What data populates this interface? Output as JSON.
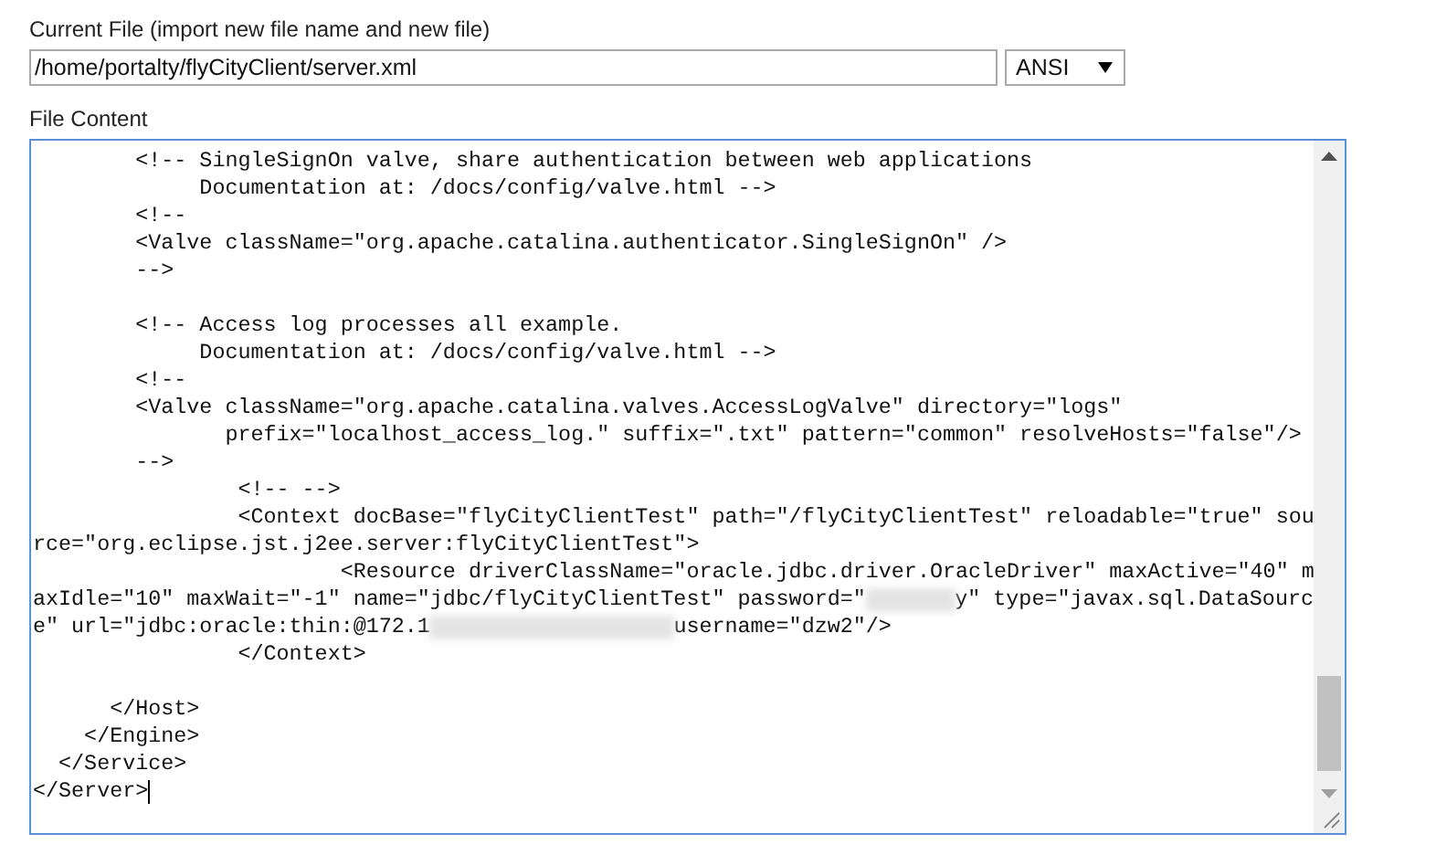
{
  "current_file": {
    "label": "Current File (import new file name and new file)",
    "value": "/home/portalty/flyCityClient/server.xml",
    "encoding": "ANSI"
  },
  "file_content": {
    "label": "File Content",
    "blocks": [
      [
        "        <!-- SingleSignOn valve, share authentication between web applications",
        "             Documentation at: /docs/config/valve.html -->",
        "        <!--",
        "        <Valve className=\"org.apache.catalina.authenticator.SingleSignOn\" />",
        "        -->"
      ],
      [
        "        <!-- Access log processes all example.",
        "             Documentation at: /docs/config/valve.html -->",
        "        <!--",
        "        <Valve className=\"org.apache.catalina.valves.AccessLogValve\" directory=\"logs\"",
        "               prefix=\"localhost_access_log.\" suffix=\".txt\" pattern=\"common\" resolveHosts=\"false\"/>",
        "        -->",
        "                <!-- -->",
        "                <Context docBase=\"flyCityClientTest\" path=\"/flyCityClientTest\" reloadable=\"true\" sou",
        "rce=\"org.eclipse.jst.j2ee.server:flyCityClientTest\">",
        "                        <Resource driverClassName=\"oracle.jdbc.driver.OracleDriver\" maxActive=\"40\" m",
        {
          "parts": [
            "axIdle=\"10\" maxWait=\"-1\" name=\"jdbc/flyCityClientTest\" password=\"",
            "y\" type=\"javax.sql.DataSourc"
          ]
        },
        {
          "parts": [
            "e\" url=\"jdbc:oracle:thin:@172.1",
            "username=\"dzw2\"/>"
          ]
        },
        "                </Context>"
      ],
      [
        "      </Host>",
        "    </Engine>",
        "  </Service>",
        "</Server>"
      ]
    ]
  }
}
